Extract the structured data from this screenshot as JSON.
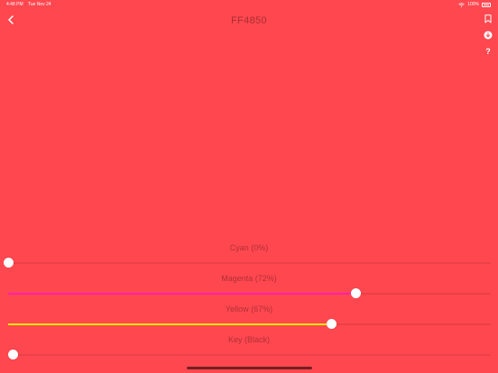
{
  "colors": {
    "background": "#ff474f",
    "magenta": "#ff1fb0",
    "yellow": "#f2e600",
    "black": "#000000"
  },
  "status_bar": {
    "time": "4:48 PM",
    "date": "Tue Nov 24",
    "battery": "100%"
  },
  "header": {
    "title": "FF4850",
    "back_icon": "chevron-left-icon"
  },
  "side_icons": [
    "bookmark-icon",
    "download-icon",
    "help-icon"
  ],
  "help_label": "?",
  "sliders": [
    {
      "label": "Cyan (0%)",
      "value": 0,
      "fill": "#ff474f"
    },
    {
      "label": "Magenta (72%)",
      "value": 0.72,
      "fill": "#ff1fb0"
    },
    {
      "label": "Yellow (67%)",
      "value": 0.67,
      "fill": "#f2e600"
    },
    {
      "label": "Key (Black)",
      "value": 0.01,
      "fill": "#000000"
    }
  ]
}
